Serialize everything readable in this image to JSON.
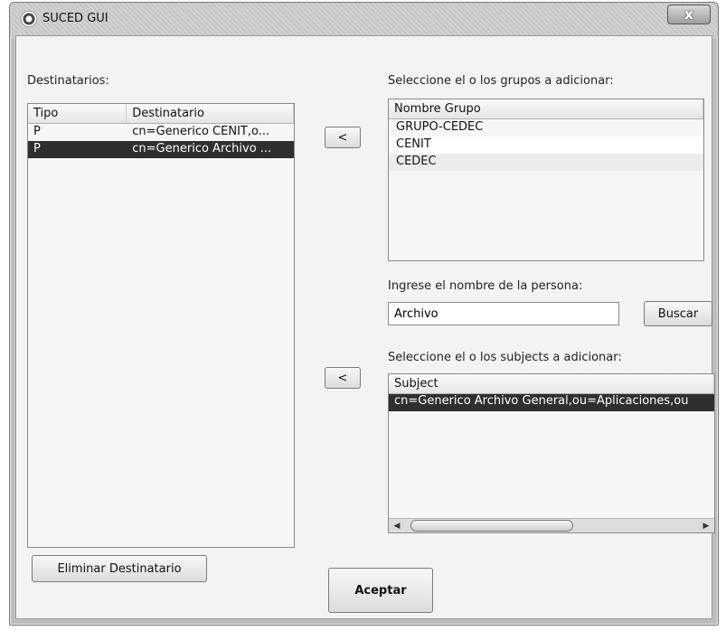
{
  "window": {
    "title": "SUCED GUI",
    "close_label": "x"
  },
  "left": {
    "label": "Destinatarios:",
    "columns": [
      "Tipo",
      "Destinatario"
    ],
    "rows": [
      {
        "tipo": "P",
        "destinatario": "cn=Generico CENIT,o...",
        "selected": false
      },
      {
        "tipo": "P",
        "destinatario": "cn=Generico Archivo ...",
        "selected": true
      }
    ],
    "delete_button": "Eliminar Destinatario"
  },
  "middle": {
    "add_group_button": "<",
    "add_subject_button": "<",
    "accept_button": "Aceptar"
  },
  "groups": {
    "label": "Seleccione el o los grupos a adicionar:",
    "column": "Nombre Grupo",
    "items": [
      "GRUPO-CEDEC",
      "CENIT",
      "CEDEC"
    ]
  },
  "person": {
    "label": "Ingrese el nombre de la persona:",
    "value": "Archivo",
    "search_button": "Buscar"
  },
  "subjects": {
    "label": "Seleccione el o los subjects a adicionar:",
    "column": "Subject",
    "items": [
      "cn=Generico Archivo General,ou=Aplicaciones,ou"
    ]
  }
}
